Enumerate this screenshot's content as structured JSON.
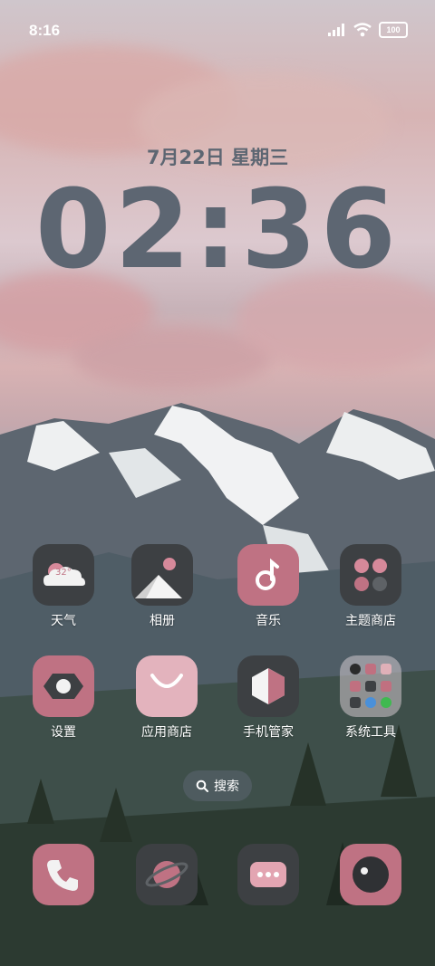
{
  "status_bar": {
    "time": "8:16",
    "battery": "100"
  },
  "lockscreen": {
    "date": "7月22日 星期三",
    "clock": "02:36"
  },
  "apps": [
    {
      "label": "天气",
      "temp": "32°"
    },
    {
      "label": "相册"
    },
    {
      "label": "音乐"
    },
    {
      "label": "主题商店"
    },
    {
      "label": "设置"
    },
    {
      "label": "应用商店"
    },
    {
      "label": "手机管家"
    },
    {
      "label": "系统工具"
    }
  ],
  "search": {
    "label": "搜索"
  },
  "dock": [
    "phone-icon",
    "browser-icon",
    "messages-icon",
    "camera-icon"
  ],
  "colors": {
    "accent_pink": "#bf7283",
    "dark_tile": "#3d4043",
    "light_pink": "#e3b3bd"
  }
}
